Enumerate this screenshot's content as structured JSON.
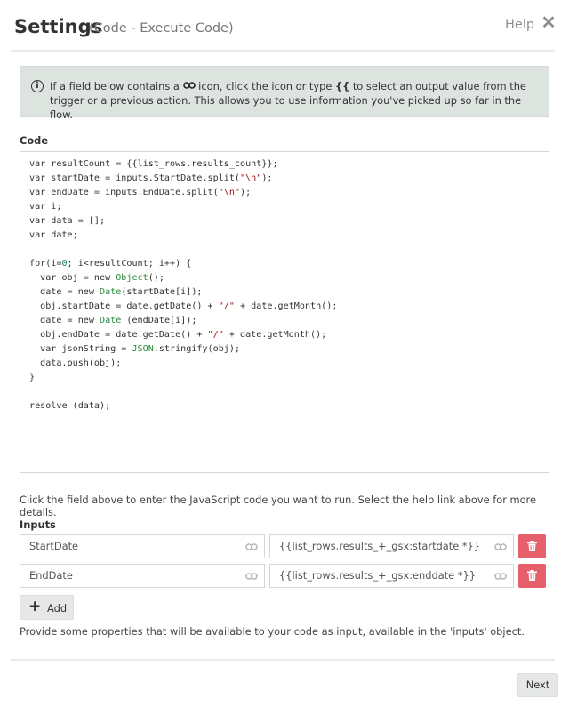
{
  "header": {
    "title": "Settings",
    "subtitle": "(Code - Execute Code)",
    "help_label": "Help",
    "close_glyph": "✕"
  },
  "info": {
    "icon": "info-icon",
    "text_part1": "If a field below contains a ",
    "text_part2": " icon, click the icon or type ",
    "brace_token": "{{",
    "text_part3": " to select an output value from the trigger or a previous action. This allows you to use information you've picked up so far in the flow."
  },
  "code_section": {
    "label": "Code",
    "lines": [
      "var resultCount = {{list_rows.results_count}};",
      "var startDate = inputs.StartDate.split(\"\\n\");",
      "var endDate = inputs.EndDate.split(\"\\n\");",
      "var i;",
      "var data = [];",
      "var date;",
      "",
      "for(i=0; i<resultCount; i++) {",
      "  var obj = new Object();",
      "  date = new Date(startDate[i]);",
      "  obj.startDate = date.getDate() + \"/\" + date.getMonth();",
      "  date = new Date (endDate[i]);",
      "  obj.endDate = date.getDate() + \"/\" + date.getMonth();",
      "  var jsonString = JSON.stringify(obj);",
      "  data.push(obj);",
      "}",
      "",
      "resolve (data);"
    ],
    "hint": "Click the field above to enter the JavaScript code you want to run. Select the help link above for more details."
  },
  "inputs_section": {
    "label": "Inputs",
    "rows": [
      {
        "name": "StartDate",
        "value": "{{list_rows.results_+_gsx:startdate *}}"
      },
      {
        "name": "EndDate",
        "value": "{{list_rows.results_+_gsx:enddate *}}"
      }
    ],
    "add_label": "Add",
    "hint": "Provide some properties that will be available to your code as input, available in the 'inputs' object."
  },
  "footer": {
    "next_label": "Next"
  },
  "colors": {
    "info_bg": "#dde4e0",
    "delete_red": "#e5606a",
    "button_gray": "#e6e8e7"
  }
}
